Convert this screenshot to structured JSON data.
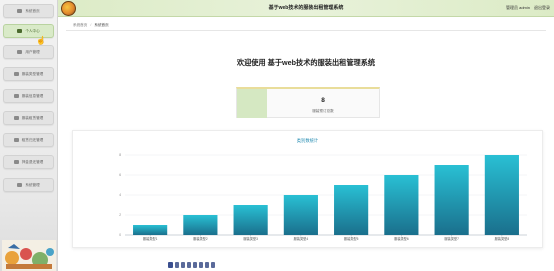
{
  "app": {
    "title": "基于web技术的服装出租管理系统",
    "user_label": "管理员 admin",
    "logout_label": "退出登录"
  },
  "sidebar": {
    "items": [
      {
        "label": "系统首页",
        "icon": "home-icon"
      },
      {
        "label": "个人中心",
        "icon": "user-icon",
        "active": true
      },
      {
        "label": "用户管理",
        "icon": "users-icon"
      },
      {
        "label": "服装类型管理",
        "icon": "grid-icon"
      },
      {
        "label": "服装信息管理",
        "icon": "grid-icon"
      },
      {
        "label": "服装租赁管理",
        "icon": "grid-icon"
      },
      {
        "label": "租赁归还管理",
        "icon": "grid-icon"
      },
      {
        "label": "押金退还管理",
        "icon": "grid-icon"
      },
      {
        "label": "系统管理",
        "icon": "grid-icon"
      }
    ]
  },
  "breadcrumb": {
    "home": "系统首页",
    "current": "系统首页"
  },
  "main": {
    "welcome": "欢迎使用 基于web技术的服装出租管理系统"
  },
  "stat": {
    "value": "8",
    "label": "服装预订总数"
  },
  "chart_data": {
    "type": "bar",
    "title": "类别数统计",
    "categories": [
      "服装类型1",
      "服装类型2",
      "服装类型3",
      "服装类型4",
      "服装类型5",
      "服装类型6",
      "服装类型7",
      "服装类型8"
    ],
    "values": [
      1,
      2,
      3,
      4,
      5,
      6,
      7,
      8
    ],
    "ylim": [
      0,
      8
    ],
    "yticks": [
      0,
      2,
      4,
      6,
      8
    ],
    "grid": true,
    "color_top": "#29c0d4",
    "color_bottom": "#1a6f8c"
  }
}
